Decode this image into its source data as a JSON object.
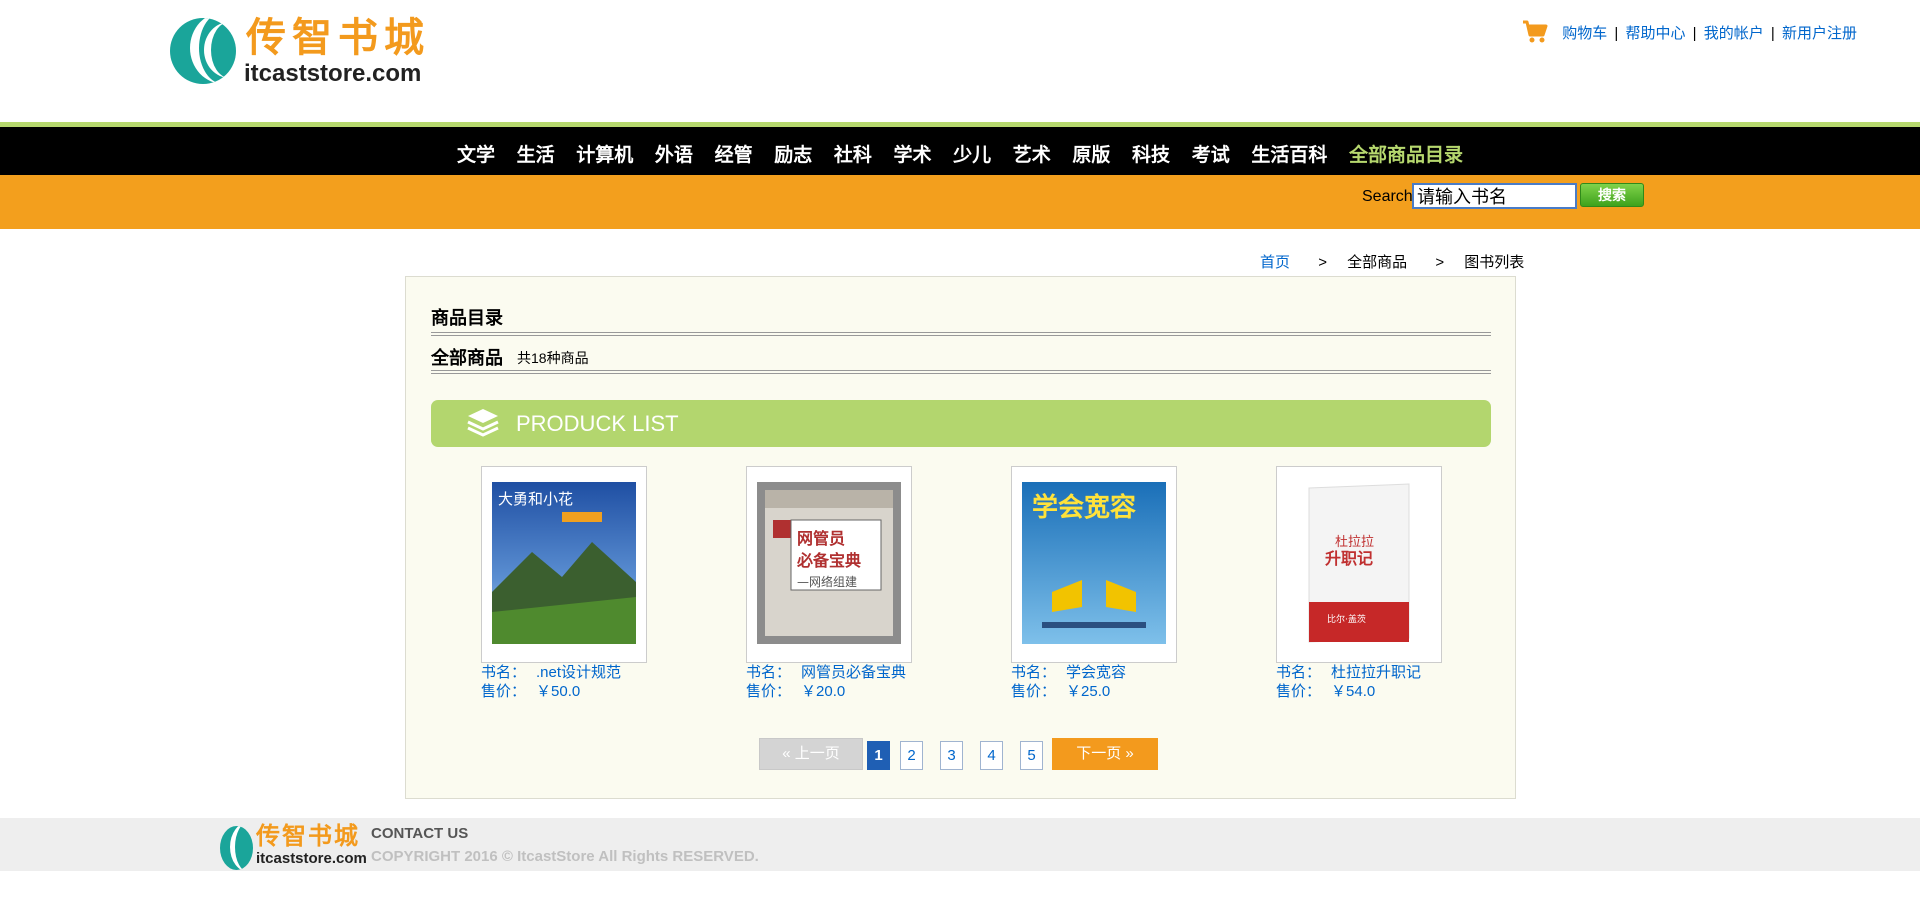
{
  "brand": {
    "name_cn": "传智书城",
    "name_en": "itcaststore.com"
  },
  "top_links": {
    "cart": "购物车",
    "help": "帮助中心",
    "account": "我的帐户",
    "register": "新用户注册",
    "separator": "|"
  },
  "nav": {
    "items": [
      "文学",
      "生活",
      "计算机",
      "外语",
      "经管",
      "励志",
      "社科",
      "学术",
      "少儿",
      "艺术",
      "原版",
      "科技",
      "考试",
      "生活百科"
    ],
    "all_goods": "全部商品目录"
  },
  "search": {
    "label": "Search",
    "value": "请输入书名",
    "button": "搜索"
  },
  "breadcrumb": {
    "home": "首页",
    "sep": ">",
    "level2": "全部商品",
    "level3": "图书列表"
  },
  "catalog": {
    "title": "商品目录",
    "all_label": "全部商品",
    "count_text": "共18种商品",
    "banner_text": "PRODUCK LIST"
  },
  "products": [
    {
      "name_label": "书名：",
      "name": ".net设计规范",
      "price_label": "售价：",
      "price": "￥50.0"
    },
    {
      "name_label": "书名：",
      "name": "网管员必备宝典",
      "price_label": "售价：",
      "price": "￥20.0"
    },
    {
      "name_label": "书名：",
      "name": "学会宽容",
      "price_label": "售价：",
      "price": "￥25.0"
    },
    {
      "name_label": "书名：",
      "name": "杜拉拉升职记",
      "price_label": "售价：",
      "price": "￥54.0"
    }
  ],
  "covers": [
    {
      "title": "大勇和小花",
      "bg": "#2a5aa8"
    },
    {
      "title": "网管员必备宝典",
      "bg": "#8a8a8a"
    },
    {
      "title": "学会宽容",
      "bg": "#1e88c8"
    },
    {
      "title": "杜拉拉升职记",
      "bg": "#f0f0f0"
    }
  ],
  "pager": {
    "prev": "上一页",
    "pages": [
      "1",
      "2",
      "3",
      "4",
      "5"
    ],
    "current": "1",
    "next": "下一页"
  },
  "footer": {
    "contact": "CONTACT US",
    "copyright": "COPYRIGHT 2016 © ItcastStore All Rights RESERVED."
  },
  "colors": {
    "accent_orange": "#f39f1d",
    "accent_green": "#b6d86e",
    "link_blue": "#0066cc",
    "nav_bg": "#000000"
  }
}
